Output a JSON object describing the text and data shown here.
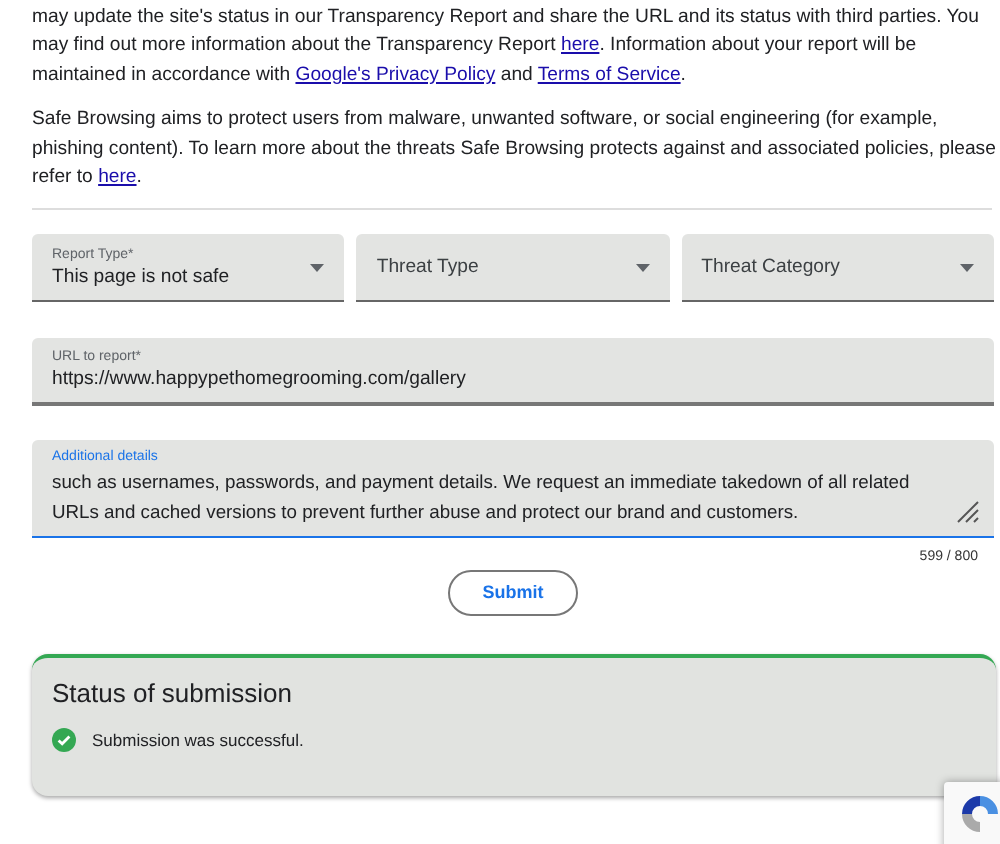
{
  "paragraphs": [
    [
      {
        "kind": "text",
        "text": "may update the site's status in our Transparency Report and share the URL and its status with third parties. You may find out more information about the Transparency Report "
      },
      {
        "kind": "link",
        "text": "here"
      },
      {
        "kind": "text",
        "text": ". Information about your report will be maintained in accordance with "
      },
      {
        "kind": "link",
        "text": "Google's Privacy Policy"
      },
      {
        "kind": "text",
        "text": " and "
      },
      {
        "kind": "link",
        "text": "Terms of Service"
      },
      {
        "kind": "text",
        "text": "."
      }
    ],
    [
      {
        "kind": "text",
        "text": "Safe Browsing aims to protect users from malware, unwanted software, or social engineering (for example, phishing content). To learn more about the threats Safe Browsing protects against and associated policies, please refer to "
      },
      {
        "kind": "link",
        "text": "here"
      },
      {
        "kind": "text",
        "text": "."
      }
    ]
  ],
  "dropdowns": [
    {
      "label": "Report Type*",
      "value": "This page is not safe"
    },
    {
      "placeholder": "Threat Type"
    },
    {
      "placeholder": "Threat Category"
    }
  ],
  "url_field": {
    "label": "URL to report*",
    "value": "https://www.happypethomegrooming.com/gallery"
  },
  "details_field": {
    "label": "Additional details",
    "value": "such as usernames, passwords, and payment details. We request an immediate takedown of all related URLs and cached versions to prevent further abuse and protect our brand and customers.",
    "focused": true,
    "counter": "599 / 800"
  },
  "submit_button": "Submit",
  "status": {
    "title": "Status of submission",
    "message": "Submission was successful.",
    "success": true
  }
}
